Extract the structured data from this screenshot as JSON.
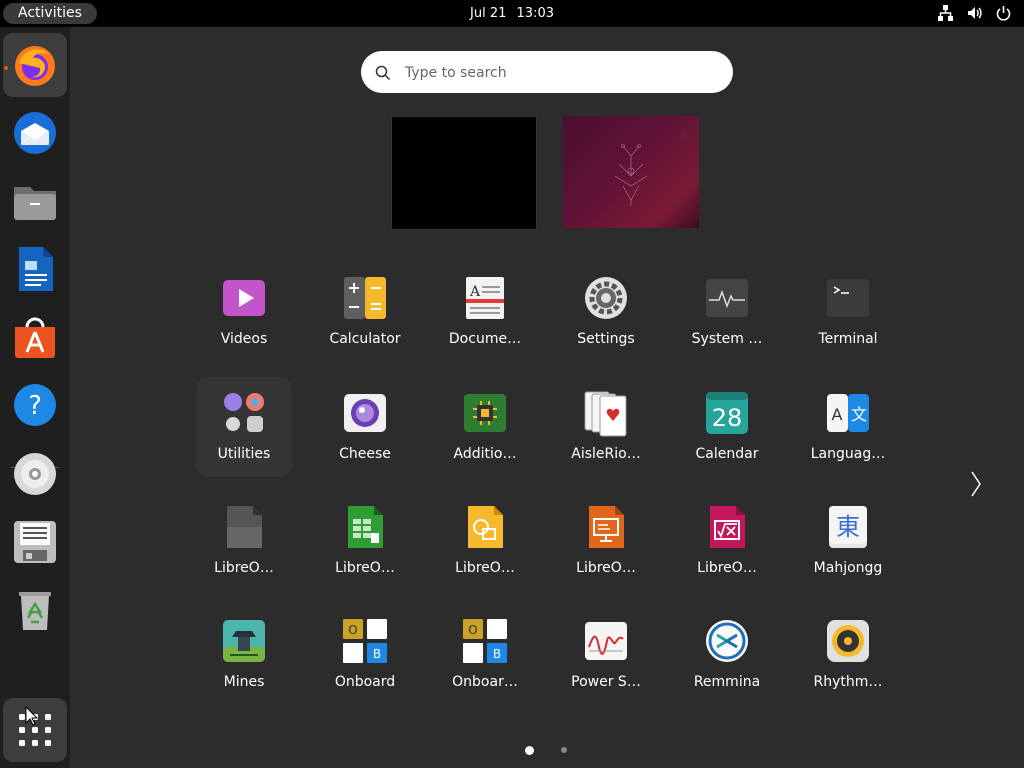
{
  "topbar": {
    "activities_label": "Activities",
    "date": "Jul 21",
    "time": "13:03"
  },
  "search": {
    "placeholder": "Type to search"
  },
  "apps": [
    {
      "label": "Videos",
      "icon": "videos-icon"
    },
    {
      "label": "Calculator",
      "icon": "calculator-icon"
    },
    {
      "label": "Docume…",
      "icon": "document-viewer-icon"
    },
    {
      "label": "Settings",
      "icon": "settings-icon"
    },
    {
      "label": "System …",
      "icon": "system-monitor-icon"
    },
    {
      "label": "Terminal",
      "icon": "terminal-icon"
    },
    {
      "label": "Utilities",
      "icon": "utilities-folder-icon"
    },
    {
      "label": "Cheese",
      "icon": "cheese-icon"
    },
    {
      "label": "Additio…",
      "icon": "additional-drivers-icon"
    },
    {
      "label": "AisleRio…",
      "icon": "aisleriot-icon"
    },
    {
      "label": "Calendar",
      "icon": "calendar-icon",
      "badge": "28"
    },
    {
      "label": "Languag…",
      "icon": "language-support-icon",
      "glyph1": "A",
      "glyph2": "文"
    },
    {
      "label": "LibreO…",
      "icon": "libreoffice-icon"
    },
    {
      "label": "LibreO…",
      "icon": "libreoffice-calc-icon"
    },
    {
      "label": "LibreO…",
      "icon": "libreoffice-draw-icon"
    },
    {
      "label": "LibreO…",
      "icon": "libreoffice-impress-icon"
    },
    {
      "label": "LibreO…",
      "icon": "libreoffice-math-icon"
    },
    {
      "label": "Mahjongg",
      "icon": "mahjongg-icon",
      "glyph": "東"
    },
    {
      "label": "Mines",
      "icon": "mines-icon"
    },
    {
      "label": "Onboard",
      "icon": "onboard-icon",
      "keys": [
        "O",
        "B"
      ]
    },
    {
      "label": "Onboar…",
      "icon": "onboard-settings-icon",
      "keys": [
        "O",
        "B"
      ]
    },
    {
      "label": "Power S…",
      "icon": "power-statistics-icon"
    },
    {
      "label": "Remmina",
      "icon": "remmina-icon"
    },
    {
      "label": "Rhythm…",
      "icon": "rhythmbox-icon"
    }
  ],
  "dock": [
    "firefox",
    "thunderbird",
    "files",
    "libreoffice-writer",
    "app-center",
    "help",
    "disc",
    "text-editor",
    "trash",
    "show-apps"
  ],
  "pagination": {
    "pages": 2,
    "current": 1
  },
  "colors": {
    "accent": "#e95420",
    "overview_bg": "#2c2c2c",
    "dock_bg": "#1f1f1f"
  }
}
